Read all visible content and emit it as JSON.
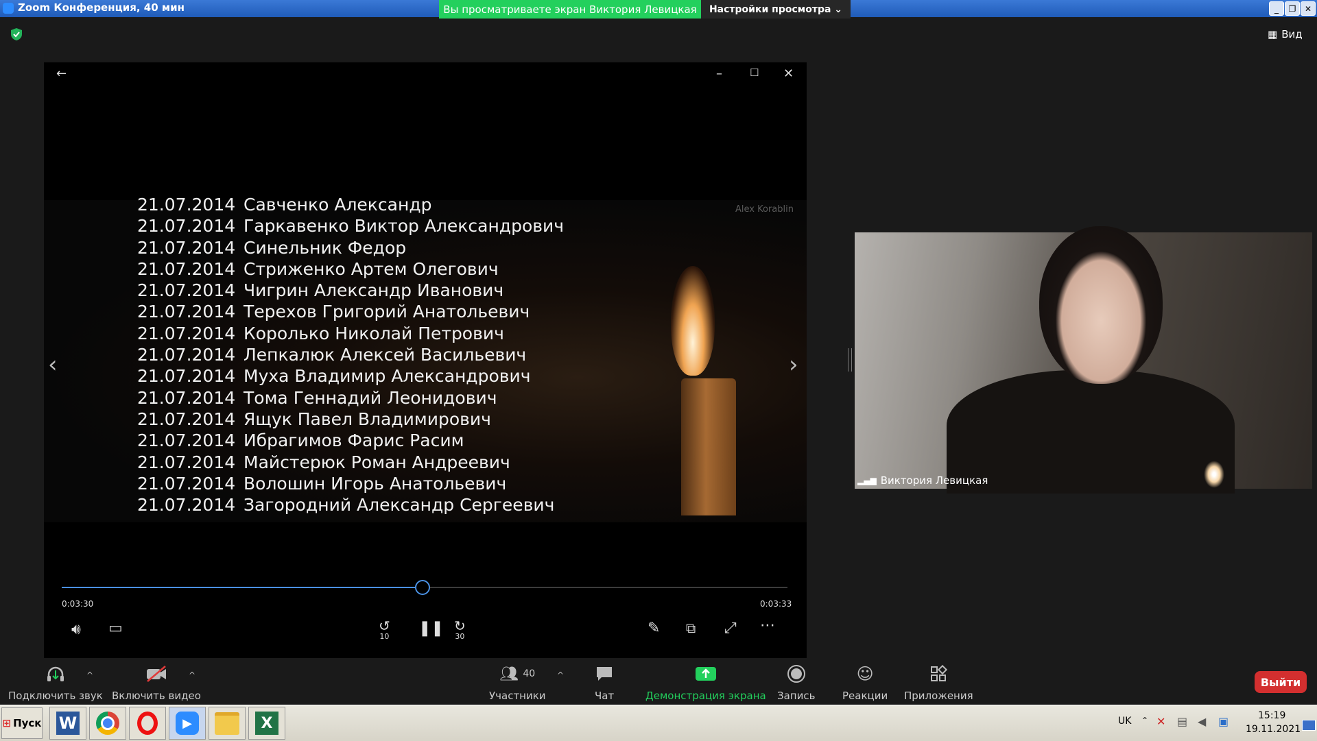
{
  "window": {
    "title": "Zoom Конференция, 40 мин",
    "viewing_banner": "Вы просматриваете экран Виктория Левицкая",
    "view_options": "Настройки просмотра ⌄",
    "view_button": "Вид"
  },
  "video": {
    "watermark": "Alex Korablin",
    "rows": [
      {
        "date": "21.07.2014",
        "name": "Савченко Александр"
      },
      {
        "date": "21.07.2014",
        "name": "Гаркавенко Виктор Александрович"
      },
      {
        "date": "21.07.2014",
        "name": "Синельник Федор"
      },
      {
        "date": "21.07.2014",
        "name": "Стриженко Артем Олегович"
      },
      {
        "date": "21.07.2014",
        "name": "Чигрин Александр Иванович"
      },
      {
        "date": "21.07.2014",
        "name": "Терехов Григорий Анатольевич"
      },
      {
        "date": "21.07.2014",
        "name": "Королько Николай Петрович"
      },
      {
        "date": "21.07.2014",
        "name": "Лепкалюк Алексей Васильевич"
      },
      {
        "date": "21.07.2014",
        "name": "Муха Владимир Александрович"
      },
      {
        "date": "21.07.2014",
        "name": "Тома Геннадий Леонидович"
      },
      {
        "date": "21.07.2014",
        "name": "Ящук Павел Владимирович"
      },
      {
        "date": "21.07.2014",
        "name": "Ибрагимов Фарис Расим"
      },
      {
        "date": "21.07.2014",
        "name": "Майстерюк Роман Андреевич"
      },
      {
        "date": "21.07.2014",
        "name": "Волошин Игорь Анатольевич"
      },
      {
        "date": "21.07.2014",
        "name": "Загородний Александр Сергеевич"
      }
    ],
    "time_current": "0:03:30",
    "time_total": "0:03:33",
    "progress_fraction": 0.497,
    "skip_back_label": "10",
    "skip_forward_label": "30"
  },
  "participant": {
    "name": "Виктория Левицкая"
  },
  "toolbar": {
    "audio": "Подключить звук",
    "video": "Включить видео",
    "participants": "Участники",
    "participants_count": "40",
    "chat": "Чат",
    "share": "Демонстрация экрана",
    "record": "Запись",
    "reactions": "Реакции",
    "apps": "Приложения",
    "leave": "Выйти"
  },
  "colors": {
    "share_green": "#23d05d",
    "progress_blue": "#4a90e2",
    "leave_red": "#d32f2f"
  },
  "taskbar": {
    "start": "Пуск",
    "lang": "UK",
    "time": "15:19",
    "date": "19.11.2021"
  }
}
